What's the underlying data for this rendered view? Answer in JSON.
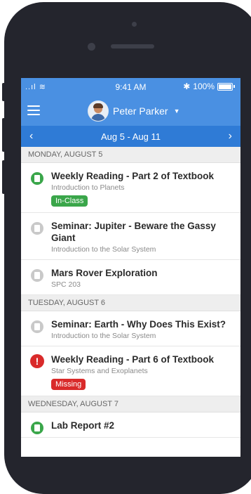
{
  "status_bar": {
    "signal": "..ıl",
    "wifi": "≋",
    "time": "9:41 AM",
    "bluetooth": "✱",
    "battery": "100%"
  },
  "header": {
    "user_name": "Peter Parker",
    "caret": "▼"
  },
  "week": {
    "prev": "‹",
    "range": "Aug 5 - Aug 11",
    "next": "›"
  },
  "days": [
    {
      "label": "MONDAY, AUGUST 5",
      "items": [
        {
          "title": "Weekly Reading - Part 2 of Textbook",
          "subtitle": "Introduction to Planets",
          "tag": "In-Class"
        },
        {
          "title": "Seminar: Jupiter - Beware the Gassy Giant",
          "subtitle": "Introduction to the Solar System"
        },
        {
          "title": "Mars Rover Exploration",
          "subtitle": "SPC 203"
        }
      ]
    },
    {
      "label": "TUESDAY, AUGUST 6",
      "items": [
        {
          "title": "Seminar: Earth - Why Does This Exist?",
          "subtitle": "Introduction to the Solar System"
        },
        {
          "title": "Weekly Reading - Part 6 of Textbook",
          "subtitle": "Star Systems and Exoplanets",
          "tag": "Missing"
        }
      ]
    },
    {
      "label": "WEDNESDAY, AUGUST 7",
      "items": [
        {
          "title": "Lab Report #2"
        }
      ]
    }
  ],
  "colors": {
    "header_blue": "#4a90e2",
    "week_blue": "#2f7bd6",
    "green": "#3aa64a",
    "red": "#d92a2a"
  }
}
